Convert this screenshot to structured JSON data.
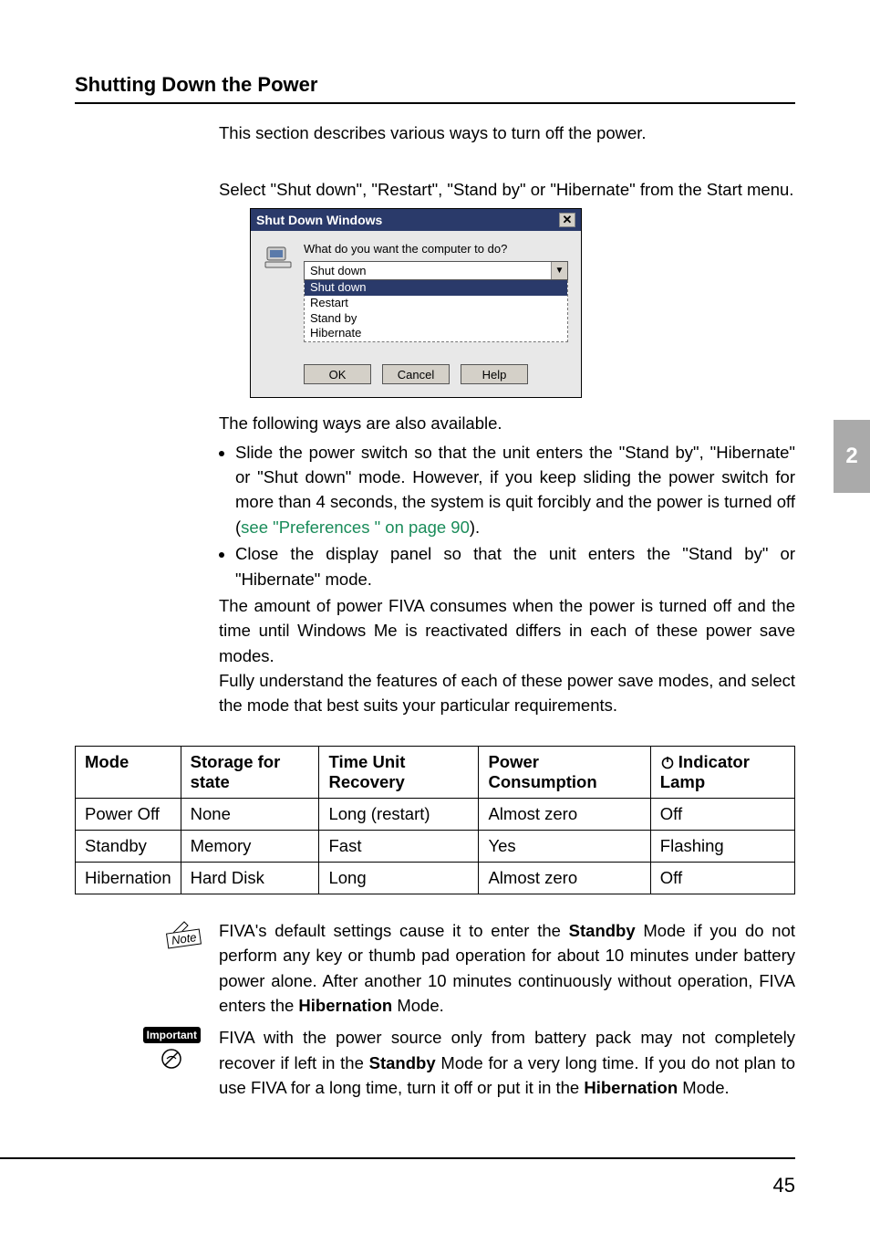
{
  "chapter_tab": "2",
  "page_number": "45",
  "heading": "Shutting Down the Power",
  "intro_para": "This section describes various ways to turn off the power.",
  "select_para": "Select \"Shut down\", \"Restart\", \"Stand by\" or \"Hibernate\" from the Start menu.",
  "dialog": {
    "title": "Shut Down Windows",
    "prompt": "What do you want the computer to do?",
    "selected": "Shut down",
    "options": [
      "Shut down",
      "Restart",
      "Stand by",
      "Hibernate"
    ],
    "ok": "OK",
    "cancel": "Cancel",
    "help": "Help"
  },
  "following_para": "The following ways are also available.",
  "bullet1_a": "Slide the power switch so that the unit enters the \"Stand by\", \"Hibernate\" or \"Shut down\" mode. However, if you keep sliding the power switch for more than 4 seconds, the system is quit forcibly and the power is turned off (",
  "bullet1_link": "see \"Preferences \" on page 90",
  "bullet1_b": ").",
  "bullet2": "Close the display panel so that the unit enters the \"Stand by\" or \"Hibernate\" mode.",
  "amount_para": "The amount of power FIVA consumes when the power is turned off and the time until Windows Me is reactivated differs in each of these power save modes.",
  "fully_para": "Fully understand the features of each of these power save modes, and select the mode that best suits your particular requirements.",
  "table": {
    "headers": {
      "mode": "Mode",
      "storage": "Storage for state",
      "time": "Time Unit Recovery",
      "power": "Power Consumption",
      "indicator": "Indicator Lamp"
    },
    "rows": [
      {
        "mode": "Power Off",
        "storage": "None",
        "time": "Long (restart)",
        "power": "Almost zero",
        "indicator": "Off"
      },
      {
        "mode": "Standby",
        "storage": "Memory",
        "time": "Fast",
        "power": "Yes",
        "indicator": "Flashing"
      },
      {
        "mode": "Hibernation",
        "storage": "Hard Disk",
        "time": "Long",
        "power": "Almost zero",
        "indicator": "Off"
      }
    ]
  },
  "note_label": "Note",
  "note_text_a": "FIVA's default settings cause it to enter the ",
  "note_standby": "Standby",
  "note_text_b": " Mode if you do not perform any key or thumb pad operation for about 10 minutes under battery power alone. After another 10 minutes continuously without operation, FIVA enters the ",
  "note_hibernation": "Hibernation",
  "note_text_c": " Mode.",
  "important_label": "Important",
  "important_text_a": "FIVA with the power source only from battery pack may not completely recover if left in the ",
  "important_standby": "Standby",
  "important_text_b": " Mode for a very long time. If you do not plan to use FIVA for a long time, turn it off or put it in the ",
  "important_hibernation": "Hibernation",
  "important_text_c": " Mode."
}
